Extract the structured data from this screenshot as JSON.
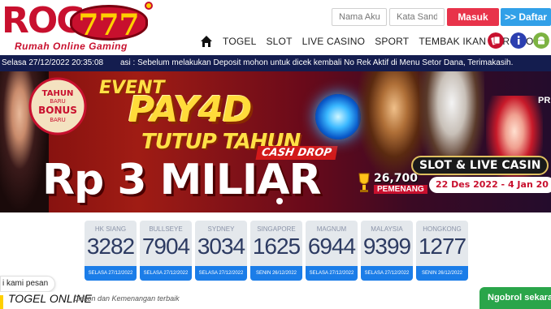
{
  "brand": {
    "logo_main": "ROG",
    "logo_number": "777",
    "tagline": "Rumah Online Gaming"
  },
  "login": {
    "username_placeholder": "Nama Akun",
    "password_placeholder": "Kata Sandi",
    "login_label": "Masuk",
    "register_label": ">> Daftar"
  },
  "nav": {
    "items": [
      "TOGEL",
      "SLOT",
      "LIVE CASINO",
      "SPORT",
      "TEMBAK IKAN",
      "PROMOSI"
    ]
  },
  "marquee": {
    "datetime": "Selasa 27/12/2022 20:35:08",
    "text": "asi : Sebelum melakukan Deposit mohon untuk dicek kembali No Rek Aktif di Menu Setor Dana, Terimakasih."
  },
  "banner": {
    "badge_line1": "TAHUN",
    "badge_line2": "BARU",
    "badge_line3": "BONUS",
    "badge_line4": "BARU",
    "event": "EVENT",
    "pay": "PAY4D",
    "tutup": "TUTUP TAHUN",
    "cash_drop": "CASH DROP",
    "prize": "Rp 3 MILIAR",
    "slot_live": "SLOT & LIVE CASIN",
    "winners_count": "26,700",
    "winners_label": "PEMENANG",
    "date_range": "22 Des 2022 - 4 Jan 20",
    "edge_text": "PR"
  },
  "results": [
    {
      "market": "HK SIANG",
      "number": "3282",
      "date": "SELASA 27/12/2022"
    },
    {
      "market": "BULLSEYE",
      "number": "7904",
      "date": "SELASA 27/12/2022"
    },
    {
      "market": "SYDNEY",
      "number": "3034",
      "date": "SELASA 27/12/2022"
    },
    {
      "market": "SINGAPORE",
      "number": "1625",
      "date": "SENIN 26/12/2022"
    },
    {
      "market": "MAGNUM",
      "number": "6944",
      "date": "SELASA 27/12/2022"
    },
    {
      "market": "MALAYSIA",
      "number": "9399",
      "date": "SELASA 27/12/2022"
    },
    {
      "market": "HONGKONG",
      "number": "1277",
      "date": "SENIN 26/12/2022"
    }
  ],
  "bottom": {
    "chat_left": "i kami pesan",
    "section_title": "TOGEL ONLINE",
    "section_sub": "Diskon dan Kemenangan terbaik",
    "chat_widget": "Ngobrol sekarang"
  },
  "colors": {
    "brand_red": "#c8102e",
    "login_button": "#e8334a",
    "register_button": "#31a0e8",
    "marquee_bg": "#141d4f",
    "result_date_bg": "#1b7de8",
    "chat_green": "#2aa54a"
  },
  "icons": {
    "home": "home-icon",
    "nav_icon_1": "cards-icon",
    "nav_icon_2": "info-icon",
    "nav_icon_3": "android-icon"
  }
}
